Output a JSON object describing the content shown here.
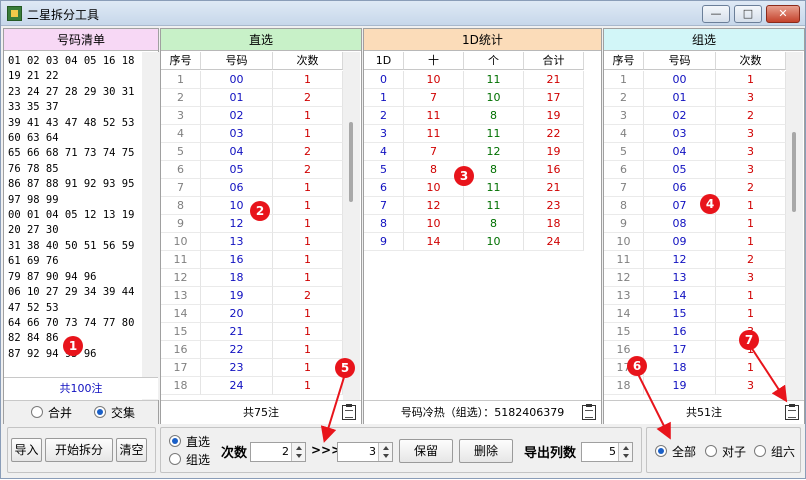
{
  "window": {
    "title": "二星拆分工具"
  },
  "titlebar_buttons": {
    "minimize": "—",
    "maximize": "□",
    "close": "✕"
  },
  "panel1": {
    "title": "号码清单",
    "lines": [
      "01 02 03 04 05 16 18",
      "19 21 22",
      "23 24 27 28 29 30 31",
      "33 35 37",
      "39 41 43 47 48 52 53",
      "60 63 64",
      "65 66 68 71 73 74 75",
      "76 78 85",
      "86 87 88 91 92 93 95",
      "97 98 99",
      "00 01 04 05 12 13 19",
      "20 27 30",
      "31 38 40 50 51 56 59",
      "61 69 76",
      "79 87 90 94 96",
      "06 10 27 29 34 39 44",
      "47 52 53",
      "64 66 70 73 74 77 80",
      "82 84 86",
      "87 92 94 95 96"
    ],
    "total": "共100注",
    "radio_merge": "合并",
    "radio_intersect": "交集"
  },
  "panel2": {
    "title": "直选",
    "headers": [
      "序号",
      "号码",
      "次数"
    ],
    "rows": [
      [
        "1",
        "00",
        "1"
      ],
      [
        "2",
        "01",
        "2"
      ],
      [
        "3",
        "02",
        "1"
      ],
      [
        "4",
        "03",
        "1"
      ],
      [
        "5",
        "04",
        "2"
      ],
      [
        "6",
        "05",
        "2"
      ],
      [
        "7",
        "06",
        "1"
      ],
      [
        "8",
        "10",
        "1"
      ],
      [
        "9",
        "12",
        "1"
      ],
      [
        "10",
        "13",
        "1"
      ],
      [
        "11",
        "16",
        "1"
      ],
      [
        "12",
        "18",
        "1"
      ],
      [
        "13",
        "19",
        "2"
      ],
      [
        "14",
        "20",
        "1"
      ],
      [
        "15",
        "21",
        "1"
      ],
      [
        "16",
        "22",
        "1"
      ],
      [
        "17",
        "23",
        "1"
      ],
      [
        "18",
        "24",
        "1"
      ]
    ],
    "total": "共75注"
  },
  "panel3": {
    "title": "1D统计",
    "headers": [
      "1D",
      "十",
      "个",
      "合计"
    ],
    "rows": [
      [
        "0",
        "10",
        "11",
        "21"
      ],
      [
        "1",
        "7",
        "10",
        "17"
      ],
      [
        "2",
        "11",
        "8",
        "19"
      ],
      [
        "3",
        "11",
        "11",
        "22"
      ],
      [
        "4",
        "7",
        "12",
        "19"
      ],
      [
        "5",
        "8",
        "8",
        "16"
      ],
      [
        "6",
        "10",
        "11",
        "21"
      ],
      [
        "7",
        "12",
        "11",
        "23"
      ],
      [
        "8",
        "10",
        "8",
        "18"
      ],
      [
        "9",
        "14",
        "10",
        "24"
      ]
    ],
    "footer": "号码冷热（组选）：5182406379"
  },
  "panel4": {
    "title": "组选",
    "headers": [
      "序号",
      "号码",
      "次数"
    ],
    "rows": [
      [
        "1",
        "00",
        "1"
      ],
      [
        "2",
        "01",
        "3"
      ],
      [
        "3",
        "02",
        "2"
      ],
      [
        "4",
        "03",
        "3"
      ],
      [
        "5",
        "04",
        "3"
      ],
      [
        "6",
        "05",
        "3"
      ],
      [
        "7",
        "06",
        "2"
      ],
      [
        "8",
        "07",
        "1"
      ],
      [
        "9",
        "08",
        "1"
      ],
      [
        "10",
        "09",
        "1"
      ],
      [
        "11",
        "12",
        "2"
      ],
      [
        "12",
        "13",
        "3"
      ],
      [
        "13",
        "14",
        "1"
      ],
      [
        "14",
        "15",
        "1"
      ],
      [
        "15",
        "16",
        "3"
      ],
      [
        "16",
        "17",
        "1"
      ],
      [
        "17",
        "18",
        "1"
      ],
      [
        "18",
        "19",
        "3"
      ]
    ],
    "total": "共51注"
  },
  "markers": [
    "1",
    "2",
    "3",
    "4",
    "5",
    "6",
    "7"
  ],
  "toolbar": {
    "import": "导入",
    "start_split": "开始拆分",
    "clear": "清空",
    "radio_direct": "直选",
    "radio_group": "组选",
    "count_label": "次数",
    "count_from": "2",
    "arrows": ">>>",
    "count_to": "3",
    "keep": "保留",
    "delete": "删除",
    "export_cols_label": "导出列数",
    "export_cols": "5",
    "filter_all": "全部",
    "filter_pair": "对子",
    "filter_six": "组六"
  },
  "colors": {
    "marker": "#e8141b",
    "arrow": "#e8141b",
    "radio_on": "#1a5fc7"
  }
}
